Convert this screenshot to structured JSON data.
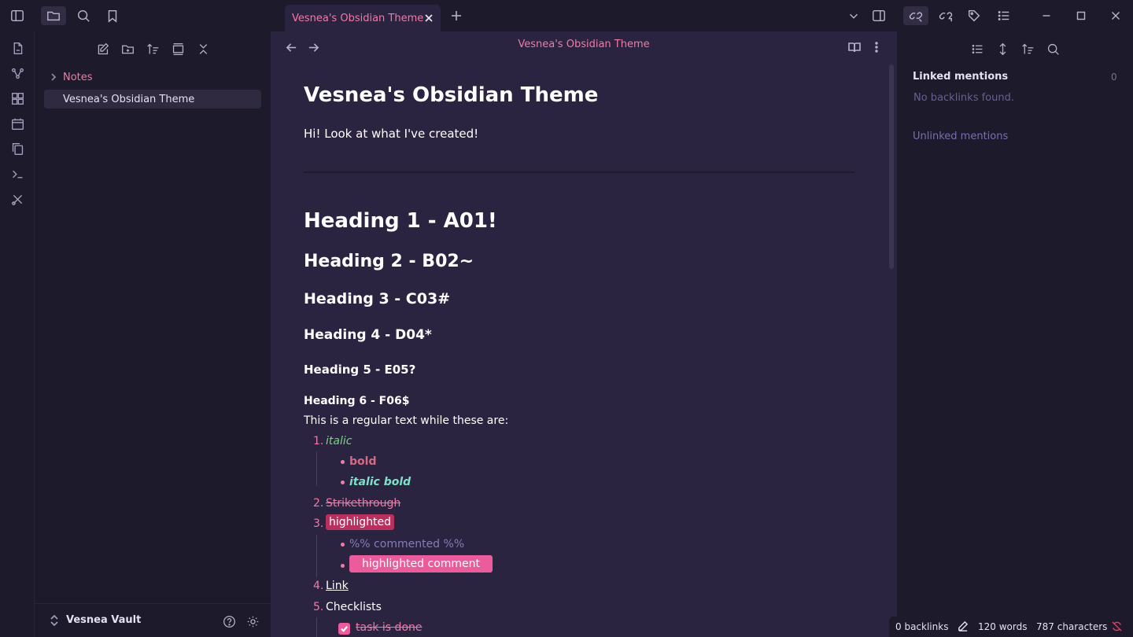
{
  "titlebar": {
    "tab_title": "Vesnea's Obsidian Theme"
  },
  "explorer": {
    "folder_label": "Notes",
    "file_label": "Vesnea's Obsidian Theme",
    "vault_name": "Vesnea Vault"
  },
  "editor": {
    "header_title": "Vesnea's Obsidian Theme",
    "doc_title": "Vesnea's Obsidian Theme",
    "intro": "Hi! Look at what I've created!",
    "h1": "Heading 1 - A01!",
    "h2": "Heading 2 - B02~",
    "h3": "Heading 3 - C03#",
    "h4": "Heading 4 - D04*",
    "h5": "Heading 5 - E05?",
    "h6": "Heading 6 - F06$",
    "regular": "This is a regular text while these are:",
    "list": {
      "n1": "1.",
      "italic": "italic",
      "bold": "bold",
      "italic_bold": "italic bold",
      "n2": "2.",
      "strikethrough": "Strikethrough",
      "n3": "3.",
      "highlighted": "highlighted",
      "comment": "%% commented %%",
      "highlighted_comment": "highlighted comment",
      "n4": "4.",
      "link": "Link",
      "n5": "5.",
      "checklists": "Checklists",
      "task_done": "task is done"
    }
  },
  "backlinks": {
    "linked_title": "Linked mentions",
    "linked_count": "0",
    "no_backlinks": "No backlinks found.",
    "unlinked_title": "Unlinked mentions"
  },
  "status": {
    "backlinks": "0 backlinks",
    "words": "120 words",
    "characters": "787 characters"
  },
  "colors": {
    "accent": "#f07aa8",
    "editor_bg": "#2b2440",
    "sidebar_bg": "#1d1a2b"
  }
}
